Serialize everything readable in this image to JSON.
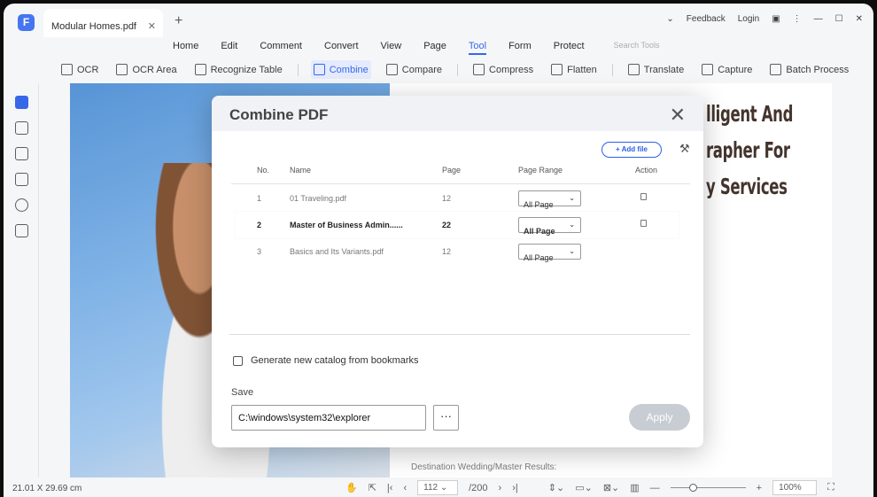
{
  "tab": {
    "title": "Modular Homes.pdf"
  },
  "titlebar": {
    "feedback": "Feedback",
    "login": "Login"
  },
  "menu": [
    "Home",
    "Edit",
    "Comment",
    "Convert",
    "View",
    "Page",
    "Tool",
    "Form",
    "Protect"
  ],
  "menu_active": "Tool",
  "search_placeholder": "Search Tools",
  "tools": [
    "OCR",
    "OCR Area",
    "Recognize Table",
    "Combine",
    "Compare",
    "Compress",
    "Flatten",
    "Translate",
    "Capture",
    "Batch Process"
  ],
  "tools_active": "Combine",
  "document": {
    "headings": [
      "lligent And",
      "rapher For",
      "y Services"
    ],
    "caption": "Destination Wedding/Master Results:"
  },
  "status": {
    "dimensions": "21.01 X 29.69 cm",
    "page": "112",
    "total": "/200",
    "zoom": "100%",
    "zoom_level_percent": 25
  },
  "dialog": {
    "title": "Combine PDF",
    "add_file": "Add file",
    "columns": [
      "No.",
      "Name",
      "Page",
      "Page Range",
      "Action"
    ],
    "rows": [
      {
        "no": "1",
        "name": "01 Traveling.pdf",
        "page": "12",
        "range": "All Page",
        "lock": true
      },
      {
        "no": "2",
        "name": "Master of Business Admin......",
        "page": "22",
        "range": "All Page",
        "lock": true,
        "selected": true
      },
      {
        "no": "3",
        "name": "Basics and Its Variants.pdf",
        "page": "12",
        "range": "All Page",
        "lock": false
      }
    ],
    "checkbox_label": "Generate new catalog from bookmarks",
    "checkbox_checked": false,
    "save_label": "Save",
    "save_path": "C:\\windows\\system32\\explorer",
    "browse": "···",
    "apply": "Apply"
  },
  "colors": {
    "accent": "#2d5fe8",
    "apply_disabled": "#c8ccd3"
  }
}
